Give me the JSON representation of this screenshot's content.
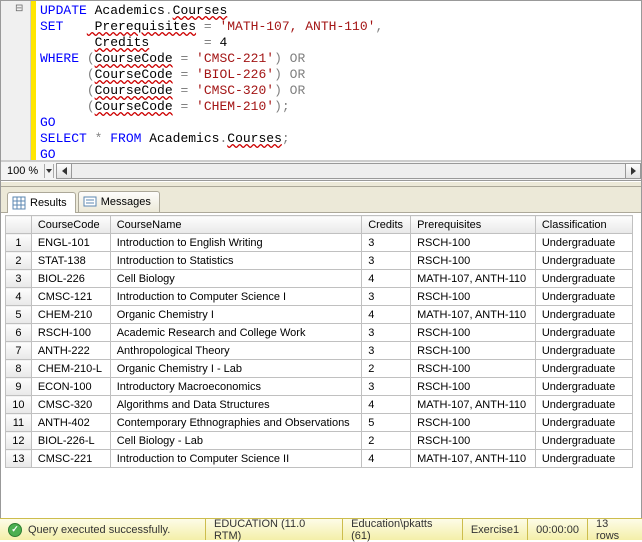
{
  "editor_lines": [
    {
      "segments": [
        {
          "t": "UPDATE",
          "c": "kw"
        },
        {
          "t": " Academics"
        },
        {
          "t": ".",
          "c": "op"
        },
        {
          "t": "Courses",
          "c": "sq"
        }
      ]
    },
    {
      "segments": [
        {
          "t": "SET   ",
          "c": "kw"
        },
        {
          "t": " Prerequisites",
          "c": "sq"
        },
        {
          "t": " = ",
          "c": "op"
        },
        {
          "t": "'MATH-107, ANTH-110'",
          "c": "str"
        },
        {
          "t": ",",
          "c": "op"
        }
      ]
    },
    {
      "segments": [
        {
          "t": "       "
        },
        {
          "t": "Credits",
          "c": "sq"
        },
        {
          "t": "       ",
          "c": ""
        },
        {
          "t": "= ",
          "c": "op"
        },
        {
          "t": "4"
        }
      ]
    },
    {
      "segments": [
        {
          "t": "WHERE ",
          "c": "kw"
        },
        {
          "t": "(",
          "c": "op"
        },
        {
          "t": "CourseCode",
          "c": "sq"
        },
        {
          "t": " = ",
          "c": "op"
        },
        {
          "t": "'CMSC-221'",
          "c": "str"
        },
        {
          "t": ")",
          "c": "op"
        },
        {
          "t": " OR",
          "c": "op"
        }
      ]
    },
    {
      "segments": [
        {
          "t": "      "
        },
        {
          "t": "(",
          "c": "op"
        },
        {
          "t": "CourseCode",
          "c": "sq"
        },
        {
          "t": " = ",
          "c": "op"
        },
        {
          "t": "'BIOL-226'",
          "c": "str"
        },
        {
          "t": ")",
          "c": "op"
        },
        {
          "t": " OR",
          "c": "op"
        }
      ]
    },
    {
      "segments": [
        {
          "t": "      "
        },
        {
          "t": "(",
          "c": "op"
        },
        {
          "t": "CourseCode",
          "c": "sq"
        },
        {
          "t": " = ",
          "c": "op"
        },
        {
          "t": "'CMSC-320'",
          "c": "str"
        },
        {
          "t": ")",
          "c": "op"
        },
        {
          "t": " OR",
          "c": "op"
        }
      ]
    },
    {
      "segments": [
        {
          "t": "      "
        },
        {
          "t": "(",
          "c": "op"
        },
        {
          "t": "CourseCode",
          "c": "sq"
        },
        {
          "t": " = ",
          "c": "op"
        },
        {
          "t": "'CHEM-210'",
          "c": "str"
        },
        {
          "t": ");",
          "c": "op"
        }
      ]
    },
    {
      "segments": [
        {
          "t": "GO",
          "c": "kw"
        }
      ]
    },
    {
      "segments": [
        {
          "t": "SELECT",
          "c": "kw"
        },
        {
          "t": " * ",
          "c": "op"
        },
        {
          "t": "FROM",
          "c": "kw"
        },
        {
          "t": " Academics"
        },
        {
          "t": ".",
          "c": "op"
        },
        {
          "t": "Courses",
          "c": "sq"
        },
        {
          "t": ";",
          "c": "op"
        }
      ]
    },
    {
      "segments": [
        {
          "t": "GO",
          "c": "kw"
        }
      ]
    }
  ],
  "zoom": "100 %",
  "tabs": {
    "results": "Results",
    "messages": "Messages"
  },
  "grid": {
    "headers": [
      "CourseCode",
      "CourseName",
      "Credits",
      "Prerequisites",
      "Classification"
    ],
    "rows": [
      [
        "ENGL-101",
        "Introduction to English Writing",
        "3",
        "RSCH-100",
        "Undergraduate"
      ],
      [
        "STAT-138",
        "Introduction to Statistics",
        "3",
        "RSCH-100",
        "Undergraduate"
      ],
      [
        "BIOL-226",
        "Cell Biology",
        "4",
        "MATH-107, ANTH-110",
        "Undergraduate"
      ],
      [
        "CMSC-121",
        "Introduction to Computer Science I",
        "3",
        "RSCH-100",
        "Undergraduate"
      ],
      [
        "CHEM-210",
        "Organic Chemistry I",
        "4",
        "MATH-107, ANTH-110",
        "Undergraduate"
      ],
      [
        "RSCH-100",
        "Academic Research and College Work",
        "3",
        "RSCH-100",
        "Undergraduate"
      ],
      [
        "ANTH-222",
        "Anthropological Theory",
        "3",
        "RSCH-100",
        "Undergraduate"
      ],
      [
        "CHEM-210-L",
        "Organic Chemistry I - Lab",
        "2",
        "RSCH-100",
        "Undergraduate"
      ],
      [
        "ECON-100",
        "Introductory Macroeconomics",
        "3",
        "RSCH-100",
        "Undergraduate"
      ],
      [
        "CMSC-320",
        "Algorithms and Data Structures",
        "4",
        "MATH-107, ANTH-110",
        "Undergraduate"
      ],
      [
        "ANTH-402",
        "Contemporary Ethnographies and Observations",
        "5",
        "RSCH-100",
        "Undergraduate"
      ],
      [
        "BIOL-226-L",
        "Cell Biology - Lab",
        "2",
        "RSCH-100",
        "Undergraduate"
      ],
      [
        "CMSC-221",
        "Introduction to Computer Science II",
        "4",
        "MATH-107, ANTH-110",
        "Undergraduate"
      ]
    ]
  },
  "status": {
    "message": "Query executed successfully.",
    "server": "EDUCATION (11.0 RTM)",
    "login": "Education\\pkatts (61)",
    "database": "Exercise1",
    "time": "00:00:00",
    "rows": "13 rows"
  }
}
